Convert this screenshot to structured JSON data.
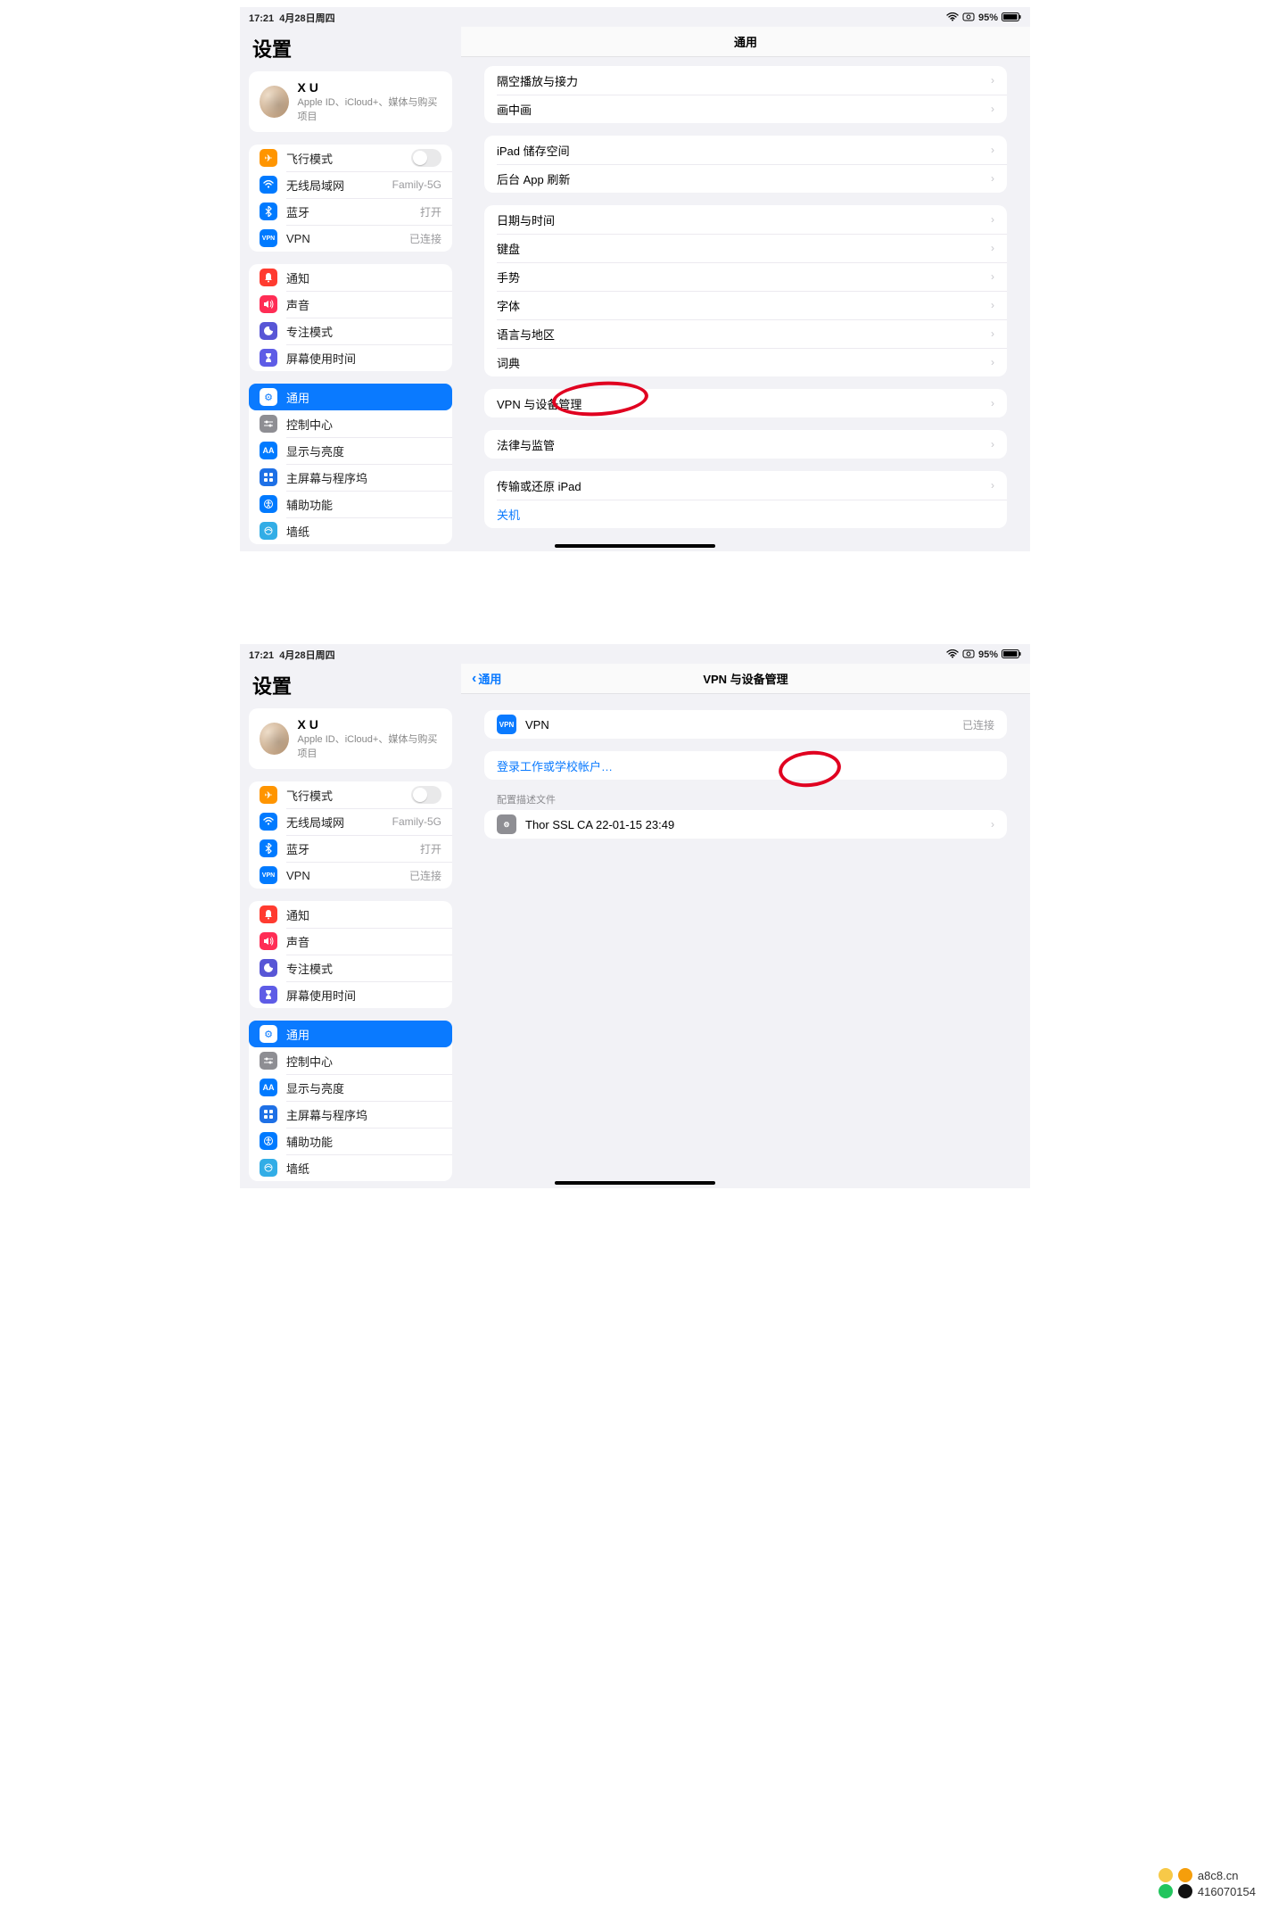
{
  "status": {
    "time": "17:21",
    "date": "4月28日周四",
    "battery": "95%"
  },
  "sidebar": {
    "title": "设置",
    "account": {
      "name": "X U",
      "sub": "Apple ID、iCloud+、媒体与购买项目"
    },
    "g1": [
      {
        "icon": "airplane",
        "label": "飞行模式",
        "toggle": true
      },
      {
        "icon": "wifi",
        "label": "无线局域网",
        "value": "Family-5G"
      },
      {
        "icon": "bt",
        "label": "蓝牙",
        "value": "打开"
      },
      {
        "icon": "vpn",
        "label": "VPN",
        "value": "已连接"
      }
    ],
    "g2": [
      {
        "icon": "bell",
        "label": "通知"
      },
      {
        "icon": "sound",
        "label": "声音"
      },
      {
        "icon": "focus",
        "label": "专注模式"
      },
      {
        "icon": "screen",
        "label": "屏幕使用时间"
      }
    ],
    "g3": [
      {
        "icon": "gear",
        "label": "通用",
        "selected": true
      },
      {
        "icon": "cc",
        "label": "控制中心"
      },
      {
        "icon": "disp",
        "label": "显示与亮度"
      },
      {
        "icon": "home",
        "label": "主屏幕与程序坞"
      },
      {
        "icon": "access",
        "label": "辅助功能"
      },
      {
        "icon": "wall",
        "label": "墙纸"
      }
    ]
  },
  "general": {
    "title": "通用",
    "g1": [
      {
        "label": "隔空播放与接力"
      },
      {
        "label": "画中画"
      }
    ],
    "g2": [
      {
        "label": "iPad 储存空间"
      },
      {
        "label": "后台 App 刷新"
      }
    ],
    "g3": [
      {
        "label": "日期与时间"
      },
      {
        "label": "键盘"
      },
      {
        "label": "手势"
      },
      {
        "label": "字体"
      },
      {
        "label": "语言与地区"
      },
      {
        "label": "词典"
      }
    ],
    "g4": [
      {
        "label": "VPN 与设备管理"
      }
    ],
    "g5": [
      {
        "label": "法律与监管"
      }
    ],
    "g6": [
      {
        "label": "传输或还原 iPad"
      },
      {
        "label": "关机",
        "link": true
      }
    ]
  },
  "vpnpage": {
    "title": "VPN 与设备管理",
    "back": "通用",
    "vpn": {
      "label": "VPN",
      "value": "已连接"
    },
    "signin": "登录工作或学校帐户…",
    "profiles_hdr": "配置描述文件",
    "profile": "Thor SSL CA 22-01-15 23:49"
  },
  "watermark": {
    "site": "a8c8.cn",
    "qq": "416070154"
  }
}
